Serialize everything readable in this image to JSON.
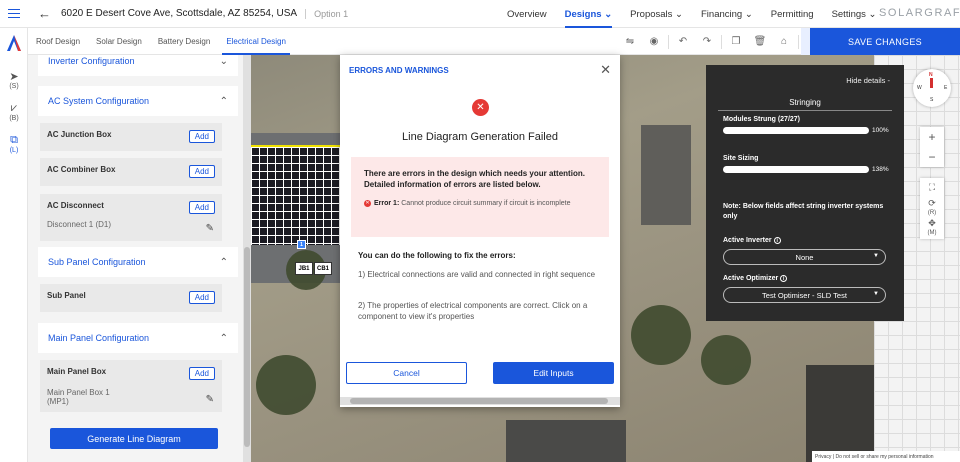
{
  "header": {
    "address": "6020 E Desert Cove Ave, Scottsdale, AZ 85254, USA",
    "option": "Option 1",
    "nav": [
      {
        "label": "Overview"
      },
      {
        "label": "Designs ⌄"
      },
      {
        "label": "Proposals ⌄"
      },
      {
        "label": "Financing ⌄"
      },
      {
        "label": "Permitting"
      },
      {
        "label": "Settings ⌄"
      }
    ],
    "brand": "SOLARGRAF"
  },
  "toolbar": {
    "tabs": [
      {
        "label": "Roof Design"
      },
      {
        "label": "Solar Design"
      },
      {
        "label": "Battery Design"
      },
      {
        "label": "Electrical Design"
      }
    ],
    "save_label": "SAVE CHANGES"
  },
  "rail": {
    "items": [
      {
        "label": "(S)"
      },
      {
        "label": "(B)"
      },
      {
        "label": "(L)"
      }
    ]
  },
  "panel": {
    "sections": [
      {
        "title": "Inverter Configuration"
      },
      {
        "title": "AC System Configuration"
      },
      {
        "title": "Sub Panel Configuration"
      },
      {
        "title": "Main Panel Configuration"
      }
    ],
    "cards": {
      "ac_junction": {
        "title": "AC Junction Box",
        "add": "Add"
      },
      "ac_combiner": {
        "title": "AC Combiner Box",
        "add": "Add"
      },
      "ac_disconnect": {
        "title": "AC Disconnect",
        "add": "Add",
        "item": "Disconnect 1 (D1)"
      },
      "sub_panel": {
        "title": "Sub Panel",
        "add": "Add"
      },
      "main_panel": {
        "title": "Main Panel Box",
        "add": "Add",
        "item_line1": "Main Panel Box 1",
        "item_line2": "(MP1)"
      }
    },
    "generate_label": "Generate Line Diagram"
  },
  "map": {
    "labels": [
      "JB1",
      "CB1"
    ],
    "panel_marker": "1"
  },
  "modal": {
    "title": "ERRORS AND WARNINGS",
    "fail_title": "Line Diagram Generation Failed",
    "error_message": "There are errors in the design which needs your attention. Detailed information of errors are listed below.",
    "error_label": "Error 1:",
    "error_text": "Cannot produce circuit summary if circuit is incomplete",
    "fix_title": "You can do the following to fix the errors:",
    "fix_1": "1) Electrical connections are valid and connected in right sequence",
    "fix_2": "2) The properties of electrical components are correct. Click on a component to view it's properties",
    "cancel_label": "Cancel",
    "edit_label": "Edit Inputs"
  },
  "stringing": {
    "hide_details": "Hide details -",
    "title": "Stringing",
    "modules_label": "Modules Strung (27/27)",
    "modules_pct": "100%",
    "modules_fill": 1.0,
    "sizing_label": "Site Sizing",
    "sizing_pct": "138%",
    "sizing_fill": 1.0,
    "note": "Note: Below fields affect string inverter systems only",
    "inverter_label": "Active Inverter",
    "inverter_value": "None",
    "optimizer_label": "Active Optimizer",
    "optimizer_value": "Test Optimiser - SLD Test"
  },
  "map_controls": {
    "compass": {
      "n": "N",
      "s": "S",
      "w": "W",
      "e": "E"
    },
    "rotate_label": "(R)",
    "move_label": "(M)"
  },
  "footer": {
    "text": "Privacy  |  Do not sell or share my personal information"
  }
}
